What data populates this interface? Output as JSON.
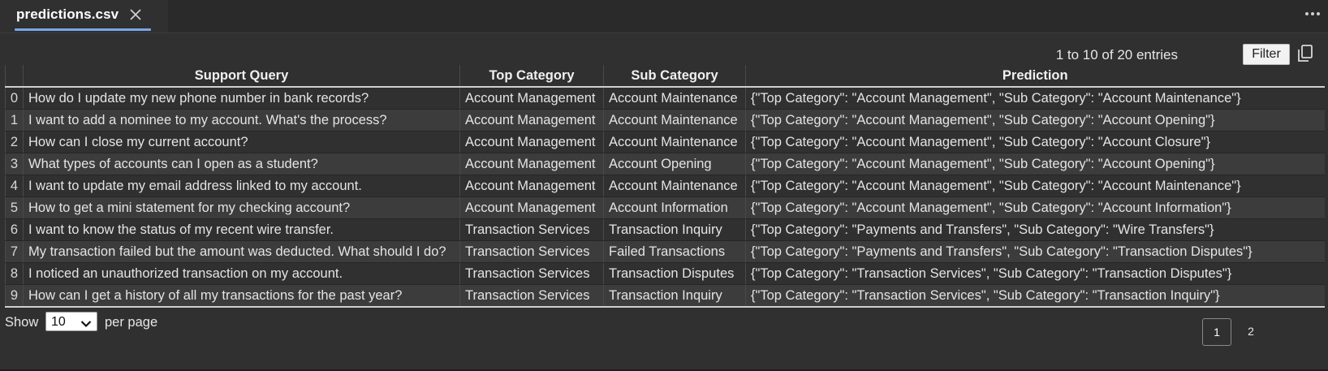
{
  "tab": {
    "title": "predictions.csv",
    "close_icon": "close-icon"
  },
  "toolbar": {
    "entries_info": "1 to 10 of 20 entries",
    "filter_label": "Filter",
    "copy_icon": "copy-icon",
    "more_icon": "more-horizontal-icon"
  },
  "table": {
    "columns": [
      "",
      "Support Query",
      "Top Category",
      "Sub Category",
      "Prediction"
    ],
    "rows": [
      [
        "0",
        "How do I update my new phone number in bank records?",
        "Account Management",
        "Account Maintenance",
        "{\"Top Category\": \"Account Management\", \"Sub Category\": \"Account Maintenance\"}"
      ],
      [
        "1",
        "I want to add a nominee to my account. What's the process?",
        "Account Management",
        "Account Maintenance",
        "{\"Top Category\": \"Account Management\", \"Sub Category\": \"Account Opening\"}"
      ],
      [
        "2",
        "How can I close my current account?",
        "Account Management",
        "Account Maintenance",
        "{\"Top Category\": \"Account Management\", \"Sub Category\": \"Account Closure\"}"
      ],
      [
        "3",
        "What types of accounts can I open as a student?",
        "Account Management",
        "Account Opening",
        "{\"Top Category\": \"Account Management\", \"Sub Category\": \"Account Opening\"}"
      ],
      [
        "4",
        "I want to update my email address linked to my account.",
        "Account Management",
        "Account Maintenance",
        "{\"Top Category\": \"Account Management\", \"Sub Category\": \"Account Maintenance\"}"
      ],
      [
        "5",
        "How to get a mini statement for my checking account?",
        "Account Management",
        "Account Information",
        "{\"Top Category\": \"Account Management\", \"Sub Category\": \"Account Information\"}"
      ],
      [
        "6",
        "I want to know the status of my recent wire transfer.",
        "Transaction Services",
        "Transaction Inquiry",
        "{\"Top Category\": \"Payments and Transfers\", \"Sub Category\": \"Wire Transfers\"}"
      ],
      [
        "7",
        "My transaction failed but the amount was deducted. What should I do?",
        "Transaction Services",
        "Failed Transactions",
        "{\"Top Category\": \"Payments and Transfers\", \"Sub Category\": \"Transaction Disputes\"}"
      ],
      [
        "8",
        "I noticed an unauthorized transaction on my account.",
        "Transaction Services",
        "Transaction Disputes",
        "{\"Top Category\": \"Transaction Services\", \"Sub Category\": \"Transaction Disputes\"}"
      ],
      [
        "9",
        "How can I get a history of all my transactions for the past year?",
        "Transaction Services",
        "Transaction Inquiry",
        "{\"Top Category\": \"Transaction Services\", \"Sub Category\": \"Transaction Inquiry\"}"
      ]
    ]
  },
  "footer": {
    "show_label": "Show",
    "per_page_value": "10",
    "per_page_label": "per page",
    "chevron_icon": "chevron-down-icon",
    "pages": [
      "1",
      "2"
    ],
    "current_page": "1"
  }
}
